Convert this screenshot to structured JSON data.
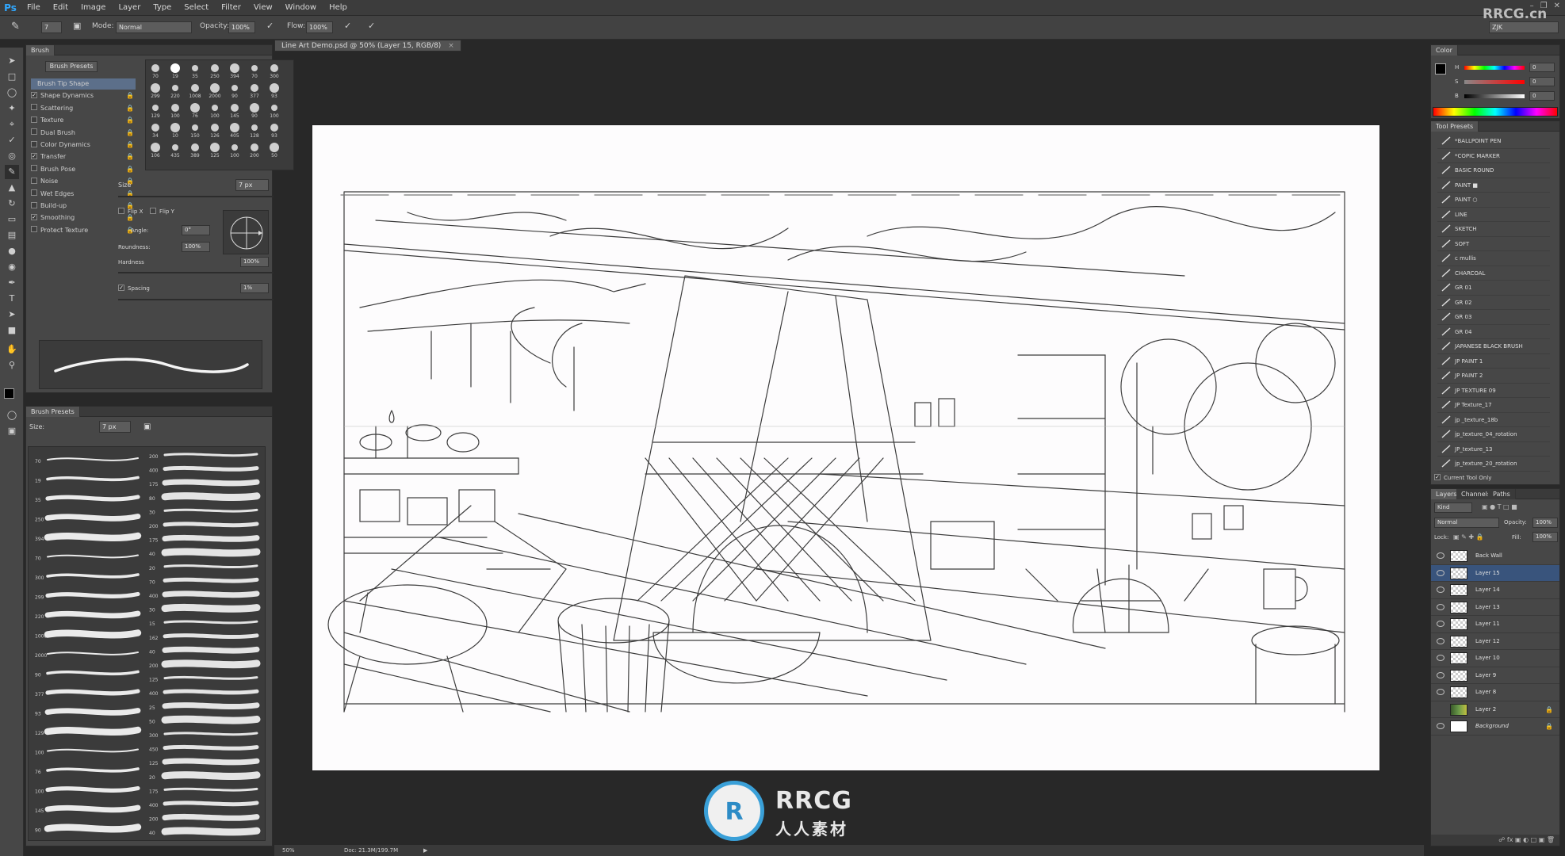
{
  "menu": {
    "logo": "Ps",
    "items": [
      "File",
      "Edit",
      "Image",
      "Layer",
      "Type",
      "Select",
      "Filter",
      "View",
      "Window",
      "Help"
    ]
  },
  "options": {
    "brush_size": "7",
    "mode_label": "Mode:",
    "mode_value": "Normal",
    "opacity_label": "Opacity:",
    "opacity_value": "100%",
    "flow_label": "Flow:",
    "flow_value": "100%",
    "workspace": "ZJK"
  },
  "doc_tab": "Line Art Demo.psd @ 50% (Layer 15, RGB/8)",
  "brush_panel": {
    "tab": "Brush",
    "presets_button": "Brush Presets",
    "items": [
      {
        "label": "Brush Tip Shape",
        "checked": null
      },
      {
        "label": "Shape Dynamics",
        "checked": true
      },
      {
        "label": "Scattering",
        "checked": false
      },
      {
        "label": "Texture",
        "checked": false
      },
      {
        "label": "Dual Brush",
        "checked": false
      },
      {
        "label": "Color Dynamics",
        "checked": false
      },
      {
        "label": "Transfer",
        "checked": true
      },
      {
        "label": "Brush Pose",
        "checked": false
      },
      {
        "label": "Noise",
        "checked": false
      },
      {
        "label": "Wet Edges",
        "checked": false
      },
      {
        "label": "Build-up",
        "checked": false
      },
      {
        "label": "Smoothing",
        "checked": true
      },
      {
        "label": "Protect Texture",
        "checked": false
      }
    ],
    "tip_sizes": [
      "70",
      "19",
      "35",
      "250",
      "394",
      "70",
      "300",
      "299",
      "220",
      "1008",
      "2000",
      "90",
      "377",
      "93",
      "129",
      "100",
      "76",
      "100",
      "145",
      "90",
      "100",
      "34",
      "10",
      "150",
      "126",
      "405",
      "128",
      "93",
      "106",
      "435",
      "389",
      "125",
      "100",
      "200",
      "50"
    ],
    "size_label": "Size",
    "size_value": "7 px",
    "flip_x": "Flip X",
    "flip_y": "Flip Y",
    "angle_label": "Angle:",
    "angle_value": "0°",
    "roundness_label": "Roundness:",
    "roundness_value": "100%",
    "hardness_label": "Hardness",
    "hardness_value": "100%",
    "spacing_label": "Spacing",
    "spacing_value": "1%"
  },
  "brush_presets_panel": {
    "tab": "Brush Presets",
    "size_label": "Size:",
    "size_value": "7 px",
    "left_numbers": [
      "70",
      "19",
      "35",
      "250",
      "394",
      "70",
      "300",
      "299",
      "220",
      "1008",
      "2000",
      "90",
      "377",
      "93",
      "129",
      "100",
      "76",
      "100",
      "145",
      "90"
    ],
    "right_numbers": [
      "200",
      "400",
      "175",
      "80",
      "30",
      "200",
      "175",
      "40",
      "20",
      "70",
      "400",
      "30",
      "15",
      "162",
      "40",
      "200",
      "125",
      "400",
      "25",
      "50",
      "300",
      "450",
      "125",
      "20",
      "175",
      "400",
      "200",
      "40"
    ]
  },
  "status": {
    "zoom": "50%",
    "doc": "Doc: 21.3M/199.7M"
  },
  "color_panel": {
    "tab": "Color",
    "channels": [
      {
        "label": "H",
        "value": "0"
      },
      {
        "label": "S",
        "value": "0"
      },
      {
        "label": "B",
        "value": "0"
      }
    ]
  },
  "tool_presets": {
    "tab": "Tool Presets",
    "items": [
      "*BALLPOINT PEN",
      "*COPIC MARKER",
      "BASIC ROUND",
      "PAINT ■",
      "PAINT ○",
      "LINE",
      "SKETCH",
      "SOFT",
      "c mullis",
      "CHARCOAL",
      "GR 01",
      "GR 02",
      "GR 03",
      "GR 04",
      "JAPANESE BLACK BRUSH",
      "JP PAINT 1",
      "JP PAINT 2",
      "JP TEXTURE 09",
      "JP Texture_17",
      "jp _texture_18b",
      "jp_texture_04_rotation",
      "JP_texture_13",
      "jp_texture_20_rotation"
    ],
    "current_only": "Current Tool Only"
  },
  "layers_panel": {
    "tabs": [
      "Layers",
      "Channels",
      "Paths"
    ],
    "kind": "Kind",
    "blend": "Normal",
    "opacity_label": "Opacity:",
    "opacity_value": "100%",
    "lock_label": "Lock:",
    "fill_label": "Fill:",
    "fill_value": "100%",
    "layers": [
      {
        "name": "Back Wall",
        "selected": false,
        "visible": true
      },
      {
        "name": "Layer 15",
        "selected": true,
        "visible": true
      },
      {
        "name": "Layer 14",
        "selected": false,
        "visible": true
      },
      {
        "name": "Layer 13",
        "selected": false,
        "visible": true
      },
      {
        "name": "Layer 11",
        "selected": false,
        "visible": true
      },
      {
        "name": "Layer 12",
        "selected": false,
        "visible": true
      },
      {
        "name": "Layer 10",
        "selected": false,
        "visible": true
      },
      {
        "name": "Layer 9",
        "selected": false,
        "visible": true
      },
      {
        "name": "Layer 8",
        "selected": false,
        "visible": true
      },
      {
        "name": "Layer 2",
        "selected": false,
        "visible": false
      },
      {
        "name": "Background",
        "selected": false,
        "visible": true
      }
    ]
  },
  "watermark": {
    "brand": "RRCG",
    "sub": "人人素材",
    "corner": "RRCG.cn"
  }
}
